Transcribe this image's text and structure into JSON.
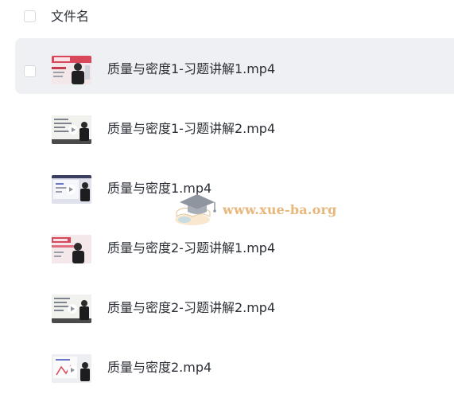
{
  "header": {
    "column_label": "文件名"
  },
  "files": [
    {
      "name": "质量与密度1-习题讲解1.mp4",
      "selected": true,
      "thumb": "title-slide"
    },
    {
      "name": "质量与密度1-习题讲解2.mp4",
      "selected": false,
      "thumb": "whiteboard-play"
    },
    {
      "name": "质量与密度1.mp4",
      "selected": false,
      "thumb": "projector-play"
    },
    {
      "name": "质量与密度2-习题讲解1.mp4",
      "selected": false,
      "thumb": "title-slide"
    },
    {
      "name": "质量与密度2-习题讲解2.mp4",
      "selected": false,
      "thumb": "whiteboard-play"
    },
    {
      "name": "质量与密度2.mp4",
      "selected": false,
      "thumb": "diagram-play"
    }
  ],
  "watermark": {
    "text": "www.xue-ba.org",
    "icon": "graduation-cap-logo"
  },
  "colors": {
    "selected_row": "#eff0f3",
    "text": "#2b2f36",
    "checkbox_border": "#d6d9de",
    "watermark": "#e8b77c"
  }
}
